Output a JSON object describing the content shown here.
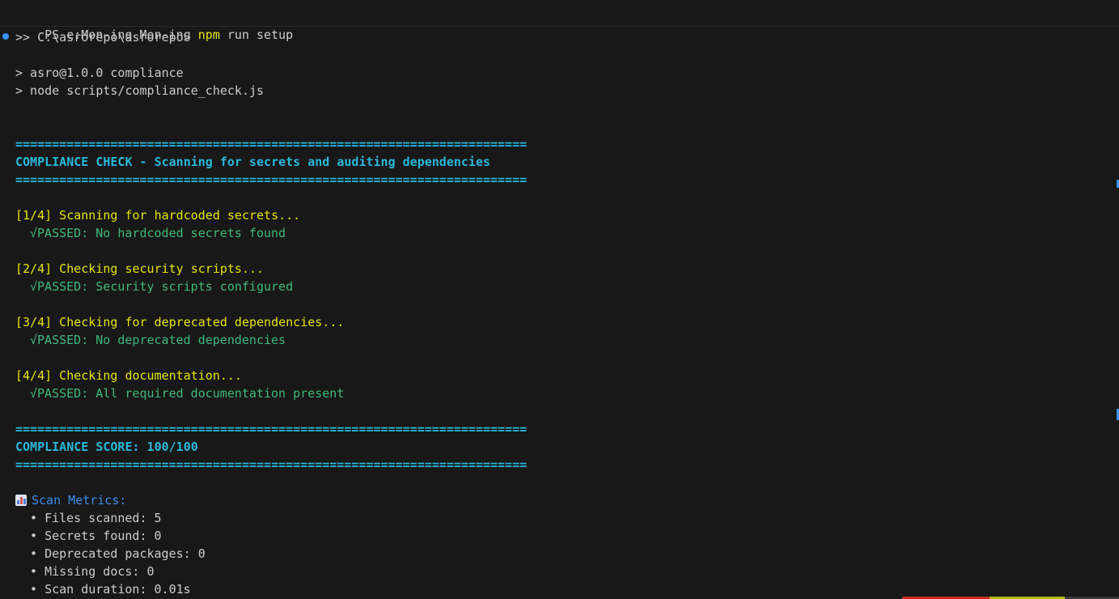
{
  "terminal": {
    "prompt": {
      "ps": "PS ",
      "garbled": "e:Mon-ing Mon-ing",
      "command_name": "npm",
      "command_args": " run setup"
    },
    "continuation": ">> C:\\asrorepo\\asrorepo>",
    "npm_header_1": "> asro@1.0.0 compliance",
    "npm_header_2": "> node scripts/compliance_check.js",
    "separator": "======================================================================",
    "title": "COMPLIANCE CHECK - Scanning for secrets and auditing dependencies",
    "steps": [
      {
        "label": "[1/4] Scanning for hardcoded secrets...",
        "check": "√",
        "result": "PASSED: No hardcoded secrets found"
      },
      {
        "label": "[2/4] Checking security scripts...",
        "check": "√",
        "result": "PASSED: Security scripts configured"
      },
      {
        "label": "[3/4] Checking for deprecated dependencies...",
        "check": "√",
        "result": "PASSED: No deprecated dependencies"
      },
      {
        "label": "[4/4] Checking documentation...",
        "check": "√",
        "result": "PASSED: All required documentation present"
      }
    ],
    "score": "COMPLIANCE SCORE: 100/100",
    "metrics_icon": "bar-chart-icon",
    "metrics_title": "Scan Metrics:",
    "bullet": "•",
    "metrics": [
      "Files scanned: 5",
      "Secrets found: 0",
      "Deprecated packages: 0",
      "Missing docs: 0",
      "Scan duration: 0.01s"
    ]
  },
  "colors": {
    "background": "#181818",
    "yellow": "#e5e510",
    "cyan": "#29b8db",
    "green": "#3fb97a",
    "text": "#cccccc"
  }
}
